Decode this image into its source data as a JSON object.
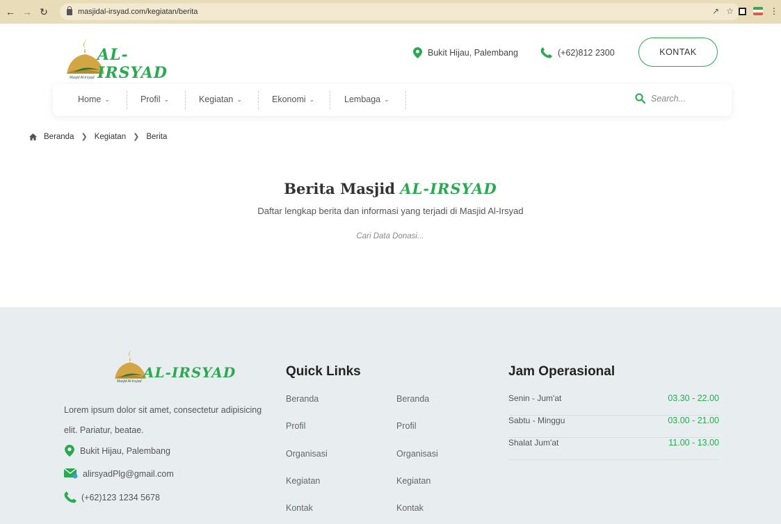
{
  "browser": {
    "url": "masjidal-irsyad.com/kegiatan/berita"
  },
  "brand": {
    "name": "AL-IRSYAD",
    "subtitle": "Masjid Al-Irsyad"
  },
  "header": {
    "location": "Bukit Hijau, Palembang",
    "phone": "(+62)812 2300",
    "cta": "KONTAK"
  },
  "menu": {
    "items": [
      {
        "label": "Home"
      },
      {
        "label": "Profil"
      },
      {
        "label": "Kegiatan"
      },
      {
        "label": "Ekonomi"
      },
      {
        "label": "Lembaga"
      }
    ],
    "search_placeholder": "Search..."
  },
  "breadcrumb": {
    "items": [
      "Beranda",
      "Kegiatan",
      "Berita"
    ]
  },
  "hero": {
    "title": "Berita Masjid",
    "title_accent": "AL-IRSYAD",
    "subtitle": "Daftar lengkap berita dan informasi yang terjadi di Masjid Al-Irsyad",
    "search_placeholder": "Cari Data Donasi..."
  },
  "footer": {
    "description": "Lorem ipsum dolor sit amet, consectetur adipisicing elit. Pariatur, beatae.",
    "address": "Bukit Hijau, Palembang",
    "email": "alirsyadPlg@gmail.com",
    "phone": "(+62)123 1234 5678",
    "quick_links_title": "Quick Links",
    "quick_links_col1": [
      "Beranda",
      "Profil",
      "Organisasi",
      "Kegiatan",
      "Kontak"
    ],
    "quick_links_col2": [
      "Beranda",
      "Profil",
      "Organisasi",
      "Kegiatan",
      "Kontak"
    ],
    "hours_title": "Jam Operasional",
    "hours": [
      {
        "day": "Senin - Jum'at",
        "time": "03.30 - 22.00"
      },
      {
        "day": "Sabtu - Minggu",
        "time": "03.00 - 21.00"
      },
      {
        "day": "Shalat Jum'at",
        "time": "11.00 - 13.00"
      }
    ]
  },
  "colors": {
    "accent": "#2aa952",
    "footer_bg": "#e8eef0",
    "browser_bar": "#e9dcb9"
  }
}
